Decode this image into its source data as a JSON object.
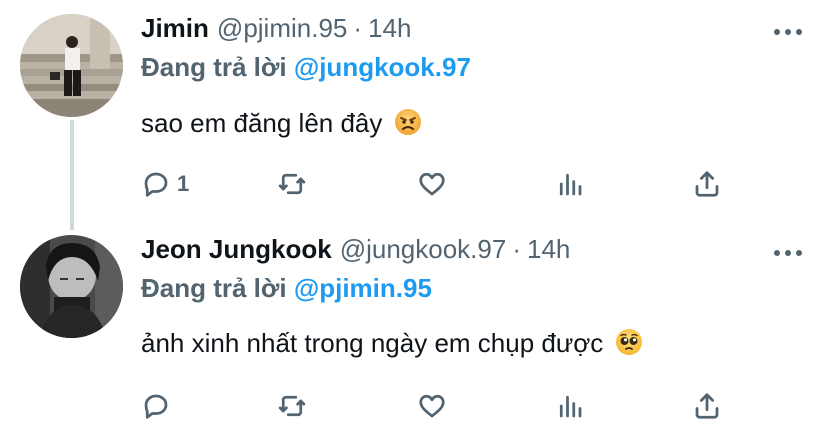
{
  "tweets": [
    {
      "name": "Jimin",
      "handle": "@pjimin.95",
      "separator": "·",
      "time": "14h",
      "replying_prefix": "Đang trả lời",
      "replying_to": "@jungkook.97",
      "text": "sao em đăng lên đây",
      "emoji": "angry-face",
      "reply_count": "1",
      "avatar": "avatar-photo"
    },
    {
      "name": "Jeon Jungkook",
      "handle": "@jungkook.97",
      "separator": "·",
      "time": "14h",
      "replying_prefix": "Đang trả lời",
      "replying_to": "@pjimin.95",
      "text": "ảnh xinh nhất trong ngày em chụp được",
      "emoji": "pleading-face",
      "reply_count": "",
      "avatar": "avatar-photo"
    }
  ],
  "colors": {
    "text": "#0f1419",
    "secondary": "#536471",
    "accent": "#1d9bf0",
    "thread_line": "#cfd9de"
  },
  "icons": [
    "reply-icon",
    "retweet-icon",
    "like-icon",
    "analytics-icon",
    "share-icon",
    "more-icon"
  ]
}
